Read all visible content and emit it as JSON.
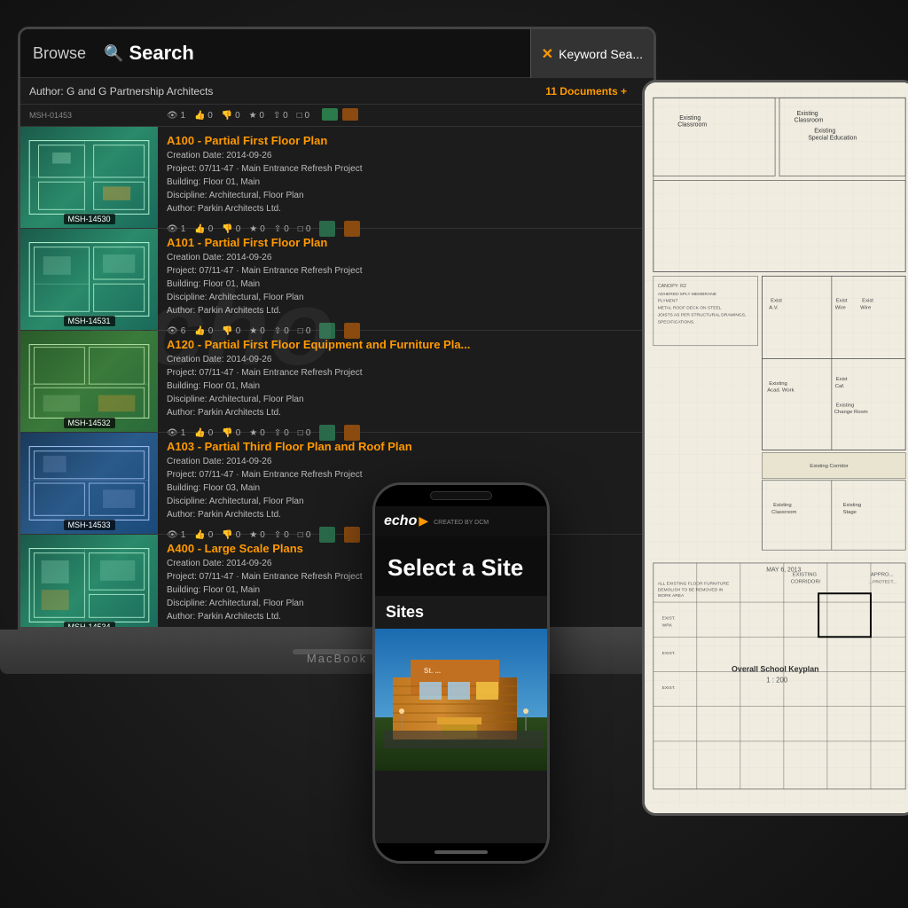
{
  "app": {
    "title": "echo",
    "subtitle": "CREATED BY DCM",
    "macbook_label": "MacBook"
  },
  "header": {
    "browse_label": "Browse",
    "search_label": "Search",
    "author": "Author: G and G Partnership Architects",
    "docs_count": "11 Documents +",
    "keyword_search": "Keyword Sea..."
  },
  "documents": [
    {
      "id": "MSH-01453",
      "title": "A100 - Partial First Floor Plan",
      "creation_date": "Creation Date: 2014-09-26",
      "project": "Project: 07/11-47 · Main Entrance Refresh Project",
      "building": "Building: Floor 01, Main",
      "discipline": "Discipline: Architectural, Floor Plan",
      "author": "Author: Parkin Architects Ltd.",
      "views": "1",
      "likes": "0",
      "dislikes": "0",
      "stars": "0",
      "shares": "0",
      "comments": "0",
      "badge_id": "MSH-14530",
      "color": "teal"
    },
    {
      "id": "MSH-14530",
      "title": "A101 - Partial First Floor Plan",
      "creation_date": "Creation Date: 2014-09-26",
      "project": "Project: 07/11-47 · Main Entrance Refresh Project",
      "building": "Building: Floor 01, Main",
      "discipline": "Discipline: Architectural, Floor Plan",
      "author": "Author: Parkin Architects Ltd.",
      "views": "6",
      "likes": "0",
      "dislikes": "0",
      "stars": "0",
      "shares": "0",
      "comments": "0",
      "badge_id": "MSH-14531",
      "color": "teal"
    },
    {
      "id": "MSH-14531",
      "title": "A120 - Partial First Floor Equipment and Furniture Pla...",
      "creation_date": "Creation Date: 2014-09-26",
      "project": "Project: 07/11-47 · Main Entrance Refresh Project",
      "building": "Building: Floor 01, Main",
      "discipline": "Discipline: Architectural, Floor Plan",
      "author": "Author: Parkin Architects Ltd.",
      "views": "1",
      "likes": "0",
      "dislikes": "0",
      "stars": "0",
      "shares": "0",
      "comments": "0",
      "badge_id": "MSH-14532",
      "color": "green"
    },
    {
      "id": "MSH-14532",
      "title": "A103 - Partial Third Floor Plan and Roof Plan",
      "creation_date": "Creation Date: 2014-09-26",
      "project": "Project: 07/11-47 · Main Entrance Refresh Project",
      "building": "Building: Floor 03, Main",
      "discipline": "Discipline: Architectural, Floor Plan",
      "author": "Author: Parkin Architects Ltd.",
      "views": "1",
      "likes": "0",
      "dislikes": "0",
      "stars": "0",
      "shares": "0",
      "comments": "0",
      "badge_id": "MSH-14533",
      "color": "blue"
    },
    {
      "id": "MSH-14533",
      "title": "A400 - Large Scale Plans",
      "creation_date": "Creation Date: 2014-09-26",
      "project": "Project: 07/11-47 · Main Entrance Refresh Project",
      "building": "Building: Floor 01, Main",
      "discipline": "Discipline: Architectural, Floor Plan",
      "author": "Author: Parkin Architects Ltd.",
      "views": "1",
      "likes": "0",
      "dislikes": "0",
      "stars": "0",
      "shares": "0",
      "comments": "0",
      "badge_id": "MSH-14534",
      "color": "teal"
    }
  ],
  "phone": {
    "select_site_text": "Select a Site",
    "sites_label": "Sites",
    "logo_text": "echo",
    "logo_arrow": "▶",
    "subtitle": "CREATED BY DCM"
  },
  "tablet": {
    "keyplan_label": "Overall School Keyplan",
    "scale": "1 : 200"
  }
}
